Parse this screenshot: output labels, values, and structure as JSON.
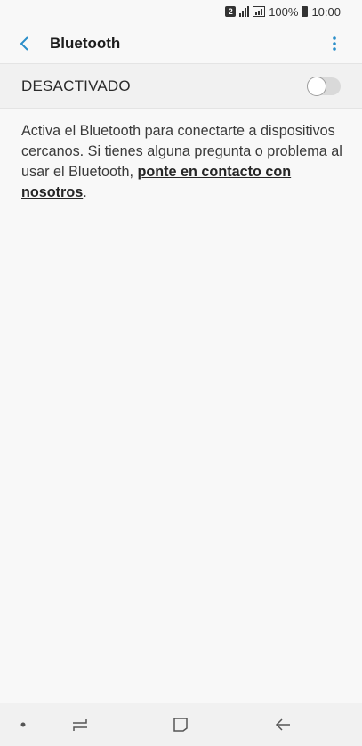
{
  "status_bar": {
    "sim_slot": "2",
    "battery_percent": "100%",
    "time": "10:00"
  },
  "app_bar": {
    "title": "Bluetooth",
    "back_icon": "chevron-left-icon",
    "more_icon": "more-vertical-icon"
  },
  "bluetooth_toggle": {
    "label": "DESACTIVADO",
    "enabled": false
  },
  "description": {
    "text_before_link": "Activa el Bluetooth para conectarte a dispositivos cercanos. Si tienes alguna pregunta o problema al usar el Bluetooth, ",
    "link_text": "ponte en contacto con nosotros",
    "text_after_link": "."
  },
  "nav_bar": {
    "items": [
      "dot-icon",
      "recents-icon",
      "home-icon",
      "back-arrow-icon"
    ]
  },
  "colors": {
    "accent": "#2a8ec9",
    "background": "#f8f8f8",
    "row_background": "#f1f1f1"
  }
}
